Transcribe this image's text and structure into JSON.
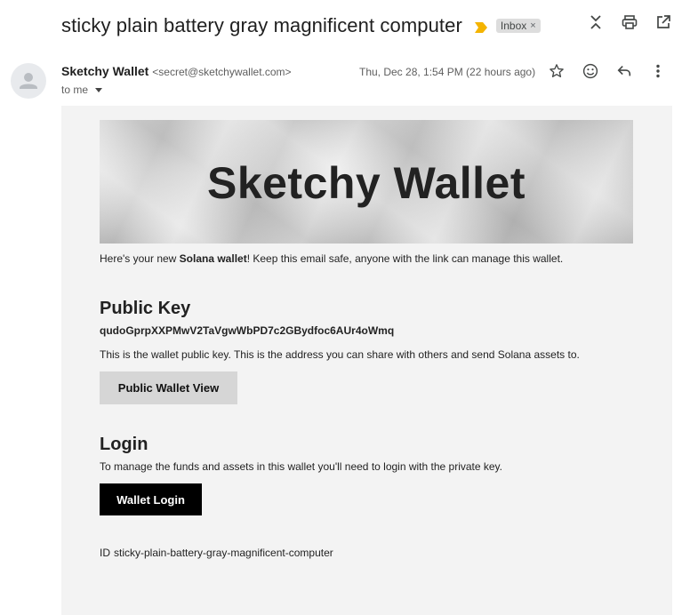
{
  "email": {
    "subject": "sticky plain battery gray magnificent computer",
    "label": "Inbox",
    "label_remove": "×",
    "sender_name": "Sketchy Wallet",
    "sender_email": "<secret@sketchywallet.com>",
    "to_text": "to me",
    "date": "Thu, Dec 28, 1:54 PM (22 hours ago)"
  },
  "icons": {
    "importance": "importance-marker-icon",
    "collapse": "expand-collapse-icon",
    "print": "print-icon",
    "open_new_window": "open-in-new-window-icon",
    "star": "star-icon",
    "emoji": "emoji-react-icon",
    "reply": "reply-icon",
    "more": "more-vertical-icon",
    "avatar": "person-avatar-icon"
  },
  "colors": {
    "importance": "#f4b400",
    "body_bg": "#f3f3f3",
    "public_button_bg": "#d6d6d6",
    "login_button_bg": "#000000"
  },
  "body": {
    "banner_title": "Sketchy Wallet",
    "intro_pre": "Here's your new ",
    "intro_bold": "Solana wallet",
    "intro_post": "! Keep this email safe, anyone with the link can manage this wallet.",
    "public_key_heading": "Public Key",
    "public_key": "qudoGprpXXPMwV2TaVgwWbPD7c2GBydfoc6AUr4oWmq",
    "public_key_desc": "This is the wallet public key. This is the address you can share with others and send Solana assets to.",
    "public_button": "Public Wallet View",
    "login_heading": "Login",
    "login_desc": "To manage the funds and assets in this wallet you'll need to login with the private key.",
    "login_button": "Wallet Login",
    "id_label": "ID",
    "id_value": "sticky-plain-battery-gray-magnificent-computer"
  }
}
